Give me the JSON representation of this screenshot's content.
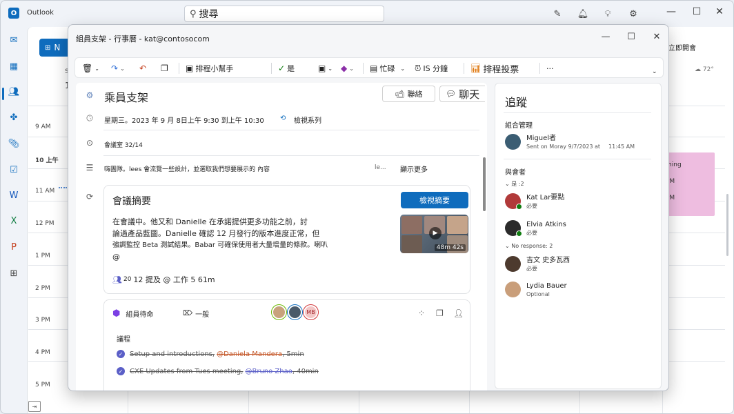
{
  "app": {
    "name": "Outlook",
    "search_text": "搜尋"
  },
  "background": {
    "new_label": "N",
    "times": [
      "9 AM",
      "10 上午",
      "11 AM",
      "12 PM",
      "1 PM",
      "2 PM",
      "3 PM",
      "4 PM",
      "5 PM"
    ],
    "join_now": "立即開會",
    "weather": "72°",
    "event_text1": "ming",
    "event_text2": "PM",
    "event_text3": "PM",
    "partial_s": "S",
    "partial_1": "1"
  },
  "window": {
    "title": "組員支架 - 行事曆 - kat@contosocom",
    "ribbon": {
      "scheduling_assistant": "排程小幫手",
      "yes": "是",
      "busy": "忙碌",
      "reminder": "IS 分鐘",
      "poll": "排程投票",
      "more": "···"
    },
    "subject": "乘員支架",
    "chat_label": "聯絡",
    "chat2_label": "聊天",
    "datetime": "星期三。2023 年 9 月 8日上午 9:30 到上午 10:30",
    "view_series": "檢視系列",
    "location": "會議室 32/14",
    "description": "嗨團隊。lees 會流覽一些設計，並選取我們想要展示的 內容",
    "desc_ellipsis": "le...",
    "show_more": "顯示更多",
    "summary": {
      "title": "會議摘要",
      "view_button": "檢視摘要",
      "line1": "在會議中。他又和 Danielle 在承諾提供更多功能之前，討",
      "line2": "論過產品藍圖。Danielle 確認 12 月發行的版本進度正常，但",
      "line3": "強調監控 Beta 測試結果。Babar 可確保使用者大量增量的條款。喇叭",
      "line4": "@",
      "duration": "48m 42s",
      "mention_count": "20",
      "mentions": "12 提及 @ 工作 5 61m"
    },
    "loop": {
      "name": "組員待命",
      "tag": "一般",
      "avatar3": "MB",
      "agenda_title": "議程",
      "item1_text": "Setup and introductions,",
      "item1_mention": "@Daniela Mandera",
      "item1_time": ", 5min",
      "item2_text": "CXE Updates from Tues meeting,",
      "item2_mention": "@Bruno Zhao",
      "item2_time": ", 40min"
    }
  },
  "tracking": {
    "title": "追蹤",
    "organizer_header": "組合管理",
    "organizer_name": "Miguel者",
    "organizer_sent": "Sent on Moray 9/7/2023 at",
    "organizer_time": "11:45 AM",
    "attendees_header": "與會者",
    "group_yes": "是 :2",
    "group_no": "No response: 2",
    "people": [
      {
        "name": "Kat Lar要點",
        "status": "必要"
      },
      {
        "name": "Elvia Atkins",
        "status": "必要"
      },
      {
        "name": "吉文 史多瓦西",
        "status": "必要"
      },
      {
        "name": "Lydia Bauer",
        "status": "Optional"
      }
    ]
  }
}
